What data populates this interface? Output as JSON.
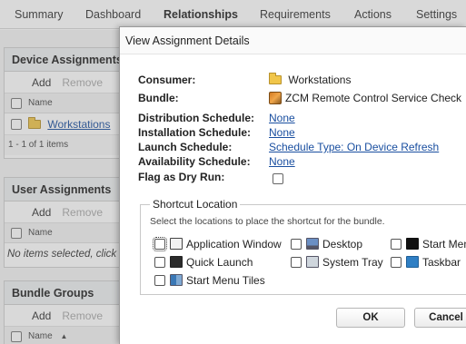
{
  "tabs": [
    {
      "label": "Summary"
    },
    {
      "label": "Dashboard"
    },
    {
      "label": "Relationships"
    },
    {
      "label": "Requirements"
    },
    {
      "label": "Actions"
    },
    {
      "label": "Settings"
    }
  ],
  "device_assignments": {
    "title": "Device Assignments",
    "add": "Add",
    "remove": "Remove",
    "column": "Name",
    "row": "Workstations",
    "footer": "1 - 1 of 1 items"
  },
  "user_assignments": {
    "title": "User Assignments",
    "add": "Add",
    "remove": "Remove",
    "column": "Name",
    "empty": "No items selected, click"
  },
  "bundle_groups": {
    "title": "Bundle Groups",
    "add": "Add",
    "remove": "Remove",
    "column": "Name",
    "sort_glyph": "▲"
  },
  "dialog": {
    "title": "View Assignment Details",
    "consumer_label": "Consumer:",
    "consumer_value": "Workstations",
    "bundle_label": "Bundle:",
    "bundle_value": "ZCM Remote Control Service Check",
    "distribution_label": "Distribution Schedule:",
    "distribution_value": "None",
    "installation_label": "Installation Schedule:",
    "installation_value": "None",
    "launch_label": "Launch Schedule:",
    "launch_value": "Schedule Type: On Device Refresh",
    "availability_label": "Availability Schedule:",
    "availability_value": "None",
    "dryrun_label": "Flag as Dry Run:",
    "shortcut": {
      "legend": "Shortcut Location",
      "hint": "Select the locations to place the shortcut for the bundle.",
      "options": {
        "app_window": "Application Window",
        "desktop": "Desktop",
        "start_menu": "Start Menu",
        "quick_launch": "Quick Launch",
        "system_tray": "System Tray",
        "taskbar": "Taskbar",
        "start_menu_tiles": "Start Menu Tiles"
      }
    },
    "ok": "OK",
    "cancel": "Cancel"
  }
}
